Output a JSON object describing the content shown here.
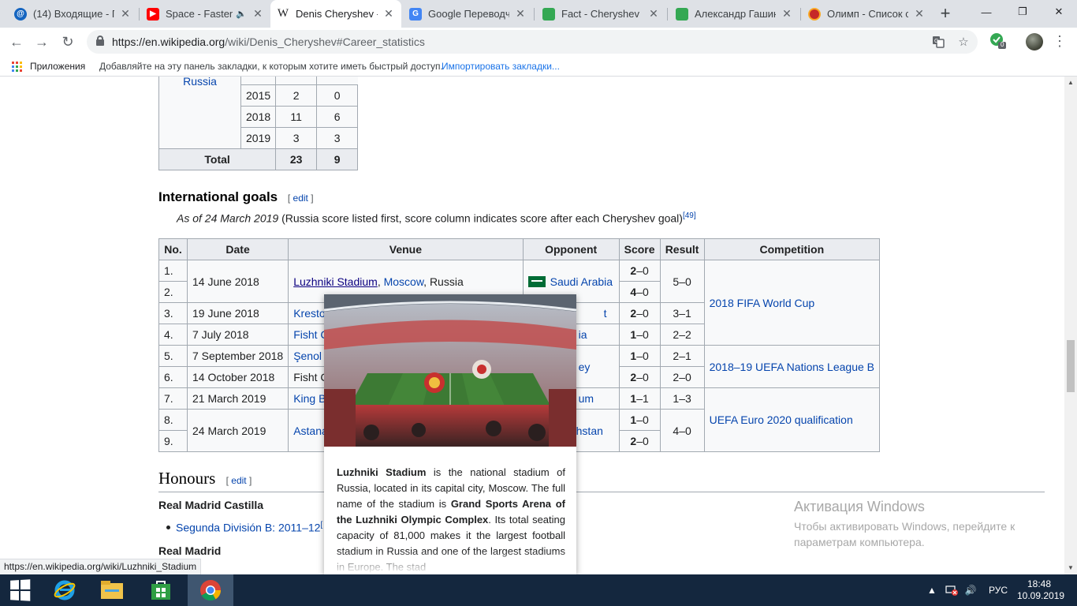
{
  "browser": {
    "tabs": [
      {
        "title": "(14) Входящие - По",
        "icon": "mail-at-icon",
        "color": "#1565c0",
        "active": false
      },
      {
        "title": "Space - Fasten",
        "icon": "youtube-icon",
        "color": "#ff0000",
        "active": false,
        "sound": true
      },
      {
        "title": "Denis Cheryshev - W",
        "icon": "wikipedia-icon",
        "color": "#202124",
        "active": true
      },
      {
        "title": "Google Переводчик",
        "icon": "google-translate-icon",
        "color": "#4285f4",
        "active": false
      },
      {
        "title": "Fact - Cheryshev 6 г",
        "icon": "sheets-icon",
        "color": "#34a853",
        "active": false
      },
      {
        "title": "Александр Гашин",
        "icon": "sheets-icon",
        "color": "#34a853",
        "active": false
      },
      {
        "title": "Олимп - Список сп",
        "icon": "olimp-icon",
        "color": "#c62828",
        "active": false
      }
    ],
    "new_tab_label": "+",
    "window_controls": {
      "minimize": "—",
      "restore": "❐",
      "close": "✕"
    },
    "nav": {
      "back": "←",
      "forward": "→",
      "reload": "↻"
    },
    "url_host": "https://en.wikipedia.org",
    "url_path": "/wiki/Denis_Cheryshev#Career_statistics",
    "extension_badge": "0",
    "bookmarks": {
      "apps_label": "Приложения",
      "hint": "Добавляйте на эту панель закладки, к которым хотите иметь быстрый доступ.",
      "import_link": "Импортировать закладки..."
    },
    "status_url": "https://en.wikipedia.org/wiki/Luzhniki_Stadium"
  },
  "caps_table": {
    "team_fragment": "Russia",
    "rows": [
      {
        "year": "2015",
        "apps": "2",
        "goals": "0"
      },
      {
        "year": "2018",
        "apps": "11",
        "goals": "6"
      },
      {
        "year": "2019",
        "apps": "3",
        "goals": "3"
      }
    ],
    "total": {
      "label": "Total",
      "apps": "23",
      "goals": "9"
    }
  },
  "international_goals": {
    "heading": "International goals",
    "edit_label": "edit",
    "as_of": "As of 24 March 2019",
    "note": " (Russia score listed first, score column indicates score after each Cheryshev goal)",
    "ref": "[49]",
    "headers": [
      "No.",
      "Date",
      "Venue",
      "Opponent",
      "Score",
      "Result",
      "Competition"
    ],
    "goals": [
      {
        "no": "1.",
        "score_bold": "2",
        "score_rest": "–0"
      },
      {
        "no": "2.",
        "score_bold": "4",
        "score_rest": "–0"
      },
      {
        "no": "3.",
        "score_bold": "2",
        "score_rest": "–0"
      },
      {
        "no": "4.",
        "score_bold": "1",
        "score_rest": "–0"
      },
      {
        "no": "5.",
        "score_bold": "1",
        "score_rest": "–0"
      },
      {
        "no": "6.",
        "score_bold": "2",
        "score_rest": "–0"
      },
      {
        "no": "7.",
        "score_bold": "1",
        "score_rest": "–1"
      },
      {
        "no": "8.",
        "score_bold": "1",
        "score_rest": "–0"
      },
      {
        "no": "9.",
        "score_bold": "2",
        "score_rest": "–0"
      }
    ],
    "dates": [
      "14 June 2018",
      "19 June 2018",
      "7 July 2018",
      "7 September 2018",
      "14 October 2018",
      "21 March 2019",
      "24 March 2019"
    ],
    "venues": {
      "luzhniki": "Luzhniki Stadium",
      "moscow": "Moscow",
      "russia": ", Russia",
      "row3": "Kresto",
      "row4": "Fisht C",
      "row5": "Şenol",
      "row6": "Fisht C",
      "row7": "King B",
      "row89": "Astana"
    },
    "opponents": {
      "saudi": "Saudi Arabia",
      "row3": "t",
      "row4": "ia",
      "row56": "ey",
      "row7": "um",
      "row89": "khstan"
    },
    "results": [
      "5–0",
      "3–1",
      "2–2",
      "2–1",
      "2–0",
      "1–3",
      "4–0"
    ],
    "competitions": [
      "2018 FIFA World Cup",
      "2018–19 UEFA Nations League B",
      "UEFA Euro 2020 qualification"
    ]
  },
  "honours": {
    "heading": "Honours",
    "edit_label": "edit",
    "club1": "Real Madrid Castilla",
    "item1": "Segunda División B: 2011–12",
    "item1_ref": "[",
    "club2": "Real Madrid"
  },
  "preview": {
    "t1": "Luzhniki Stadium",
    "t2": " is the national stadium of Russia, located in its capital city, Moscow. The full name of the stadium is ",
    "t3": "Grand Sports Arena of the Luzhniki Olympic Complex",
    "t4": ". Its total seating capacity of 81,000 makes it the largest football stadium in Russia and one of the largest stadiums in Europe. The stad"
  },
  "watermark": {
    "title": "Активация Windows",
    "line": "Чтобы активировать Windows, перейдите к параметрам компьютера."
  },
  "tray": {
    "language": "РУС",
    "time": "18:48",
    "date": "10.09.2019"
  }
}
